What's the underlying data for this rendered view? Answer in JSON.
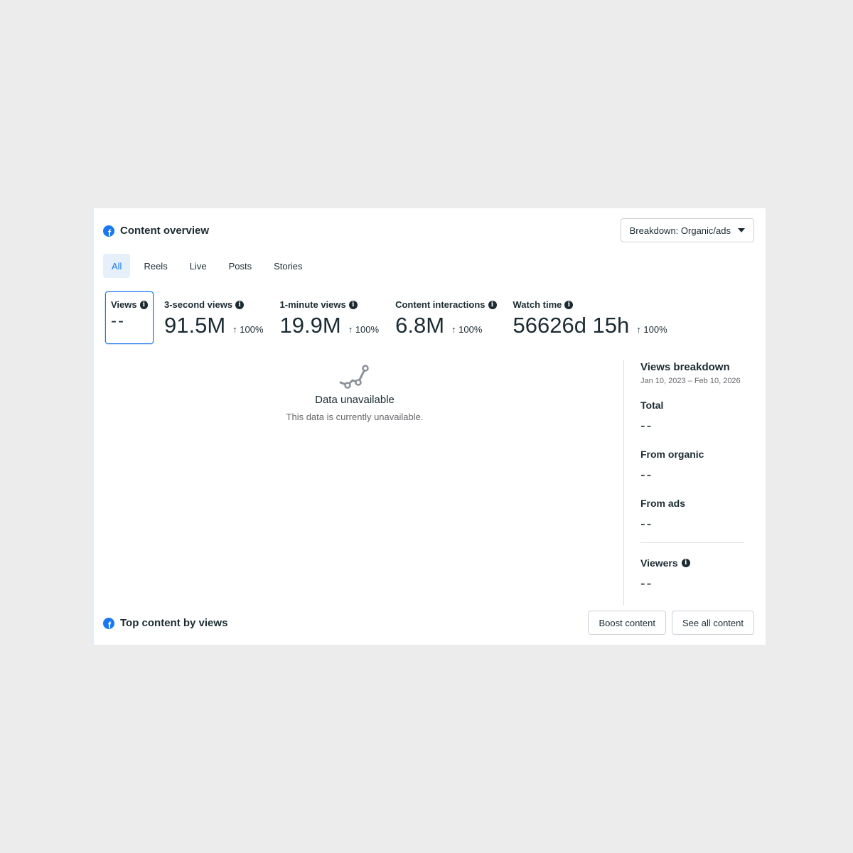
{
  "header": {
    "title": "Content overview",
    "breakdown_label": "Breakdown: Organic/ads",
    "logo_icon": "facebook-icon"
  },
  "tabs": [
    {
      "label": "All",
      "active": true
    },
    {
      "label": "Reels",
      "active": false
    },
    {
      "label": "Live",
      "active": false
    },
    {
      "label": "Posts",
      "active": false
    },
    {
      "label": "Stories",
      "active": false
    }
  ],
  "metrics": [
    {
      "label": "Views",
      "value": "--",
      "change": "",
      "selected": true
    },
    {
      "label": "3-second views",
      "value": "91.5M",
      "change": "↑ 100%"
    },
    {
      "label": "1-minute views",
      "value": "19.9M",
      "change": "↑ 100%"
    },
    {
      "label": "Content interactions",
      "value": "6.8M",
      "change": "↑ 100%"
    },
    {
      "label": "Watch time",
      "value": "56626d 15h",
      "change": "↑ 100%"
    }
  ],
  "empty_state": {
    "title": "Data unavailable",
    "subtitle": "This data is currently unavailable.",
    "icon": "line-chart-icon"
  },
  "views_breakdown": {
    "title": "Views breakdown",
    "date_range": "Jan 10, 2023 – Feb 10, 2026",
    "total_label": "Total",
    "total_value": "--",
    "organic_label": "From organic",
    "organic_value": "--",
    "ads_label": "From ads",
    "ads_value": "--",
    "viewers_label": "Viewers",
    "viewers_value": "--"
  },
  "top_content": {
    "title": "Top content by views",
    "boost_label": "Boost content",
    "see_all_label": "See all content"
  },
  "colors": {
    "accent": "#1877f2",
    "text": "#1c2b33",
    "muted": "#65676b",
    "background": "#ececec"
  }
}
